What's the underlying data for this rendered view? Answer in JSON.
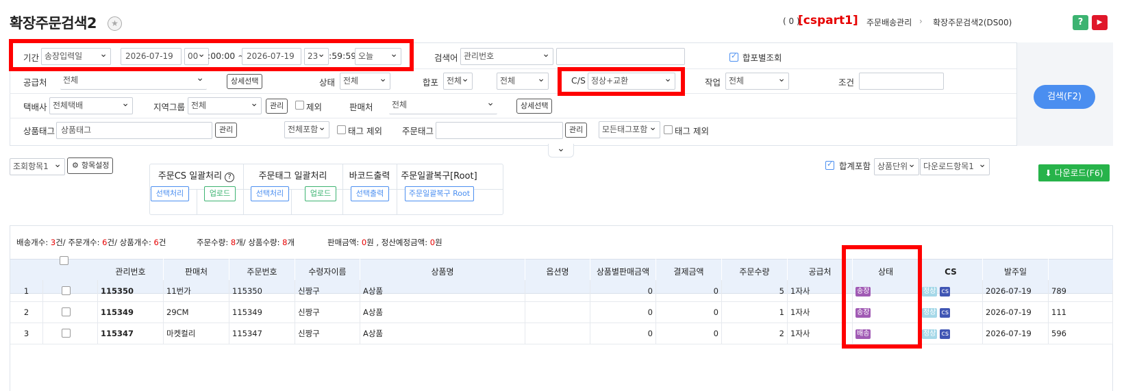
{
  "header": {
    "title": "확장주문검색2",
    "count_label": "( 0 )",
    "user_id": "[cspart1]",
    "breadcrumb_parent": "주문배송관리",
    "breadcrumb_current": "확장주문검색2(DS00)",
    "help_label": "?",
    "video_label": "▶"
  },
  "filters": {
    "period_label": "기간",
    "period_type": "송장입력일",
    "date_from": "2026-07-19",
    "hour_from": "00",
    "time_from_suffix": ":00:00 ~",
    "date_to": "2026-07-19",
    "hour_to": "23",
    "time_to_suffix": ":59:59",
    "quick_period": "오늘",
    "keyword_label": "검색어",
    "keyword_type": "관리번호",
    "keyword_value": "",
    "merge_view_label": "합포별조회",
    "supplier_label": "공급처",
    "supplier_value": "전체",
    "detail_select_label": "상세선택",
    "status_label": "상태",
    "status_value": "전체",
    "merge_label": "합포",
    "merge_value1": "전체",
    "merge_value2": "전체",
    "cs_label": "C/S",
    "cs_value": "정상+교환",
    "work_label": "작업",
    "work_value": "전체",
    "condition_label": "조건",
    "condition_value": "",
    "courier_label": "택배사",
    "courier_value": "전체택배",
    "region_label": "지역그룹",
    "region_value": "전체",
    "manage_label": "관리",
    "exclude_label": "제외",
    "seller_label": "판매처",
    "seller_value": "전체",
    "seller_detail_label": "상세선택",
    "product_tag_label": "상품태그",
    "product_tag_placeholder": "상품태그",
    "product_tag_manage": "관리",
    "product_tag_scope": "전체포함",
    "tag_exclude_label": "태그 제외",
    "order_tag_label": "주문태그",
    "order_tag_value": "",
    "order_tag_manage": "관리",
    "order_tag_scope": "모든태그포함",
    "order_tag_exclude_label": "태그 제외",
    "search_button": "검색(F2)",
    "collapse_icon": "⌄"
  },
  "toolbar": {
    "view_item": "조회항목1",
    "column_settings": "항목설정",
    "bulk_cs_title": "주문CS 일괄처리",
    "bulk_cs_select": "선택처리",
    "bulk_cs_upload": "업로드",
    "bulk_tag_title": "주문태그 일괄처리",
    "bulk_tag_select": "선택처리",
    "bulk_tag_upload": "업로드",
    "barcode_title": "바코드출력",
    "barcode_select": "선택출력",
    "restore_title": "주문일괄복구[Root]",
    "restore_button": "주문일괄복구 Root",
    "include_total_label": "합계포함",
    "unit_value": "상품단위",
    "download_item": "다운로드항목1",
    "download_button": "다운로드(F6)"
  },
  "summary": {
    "ship_label": "배송개수:",
    "ship_count": "3",
    "ship_unit": "건/",
    "order_label": "주문개수:",
    "order_count": "6",
    "order_unit": "건/",
    "product_label": "상품개수:",
    "product_count": "6",
    "product_unit": "건",
    "order_qty_label": "주문수량:",
    "order_qty": "8",
    "order_qty_unit": "개/",
    "product_qty_label": "상품수량:",
    "product_qty": "8",
    "product_qty_unit": "개",
    "sales_label": "판매금액:",
    "sales_amount": "0",
    "sales_unit": "원 ,",
    "settle_label": "정산예정금액:",
    "settle_amount": "0",
    "settle_unit": "원"
  },
  "table": {
    "columns": [
      "관리번호",
      "판매처",
      "주문번호",
      "수령자이름",
      "상품명",
      "옵션명",
      "상품별판매금액",
      "결제금액",
      "주문수량",
      "공급처",
      "상태",
      "CS",
      "발주일"
    ],
    "rows": [
      {
        "no": "1",
        "mgmt": "115350",
        "seller": "11번가",
        "order_no": "115350",
        "receiver": "신짱구",
        "product": "A상품",
        "option": "",
        "item_amount": "0",
        "pay_amount": "0",
        "qty": "5",
        "supplier": "1자사",
        "status": "송장",
        "cs1": "정상",
        "cs2": "cs",
        "order_date": "2026-07-19",
        "extra": "789"
      },
      {
        "no": "2",
        "mgmt": "115349",
        "seller": "29CM",
        "order_no": "115349",
        "receiver": "신짱구",
        "product": "A상품",
        "option": "",
        "item_amount": "0",
        "pay_amount": "0",
        "qty": "1",
        "supplier": "1자사",
        "status": "송장",
        "cs1": "정상",
        "cs2": "cs",
        "order_date": "2026-07-19",
        "extra": "111"
      },
      {
        "no": "3",
        "mgmt": "115347",
        "seller": "마켓컬리",
        "order_no": "115347",
        "receiver": "신짱구",
        "product": "A상품",
        "option": "",
        "item_amount": "0",
        "pay_amount": "0",
        "qty": "2",
        "supplier": "1자사",
        "status": "배송",
        "cs1": "정상",
        "cs2": "cs",
        "order_date": "2026-07-19",
        "extra": "596"
      }
    ]
  },
  "colors": {
    "accent": "#4a8ef0",
    "download": "#27b34a",
    "highlight": "#ff0000",
    "status_tag": "#a05ab4"
  }
}
